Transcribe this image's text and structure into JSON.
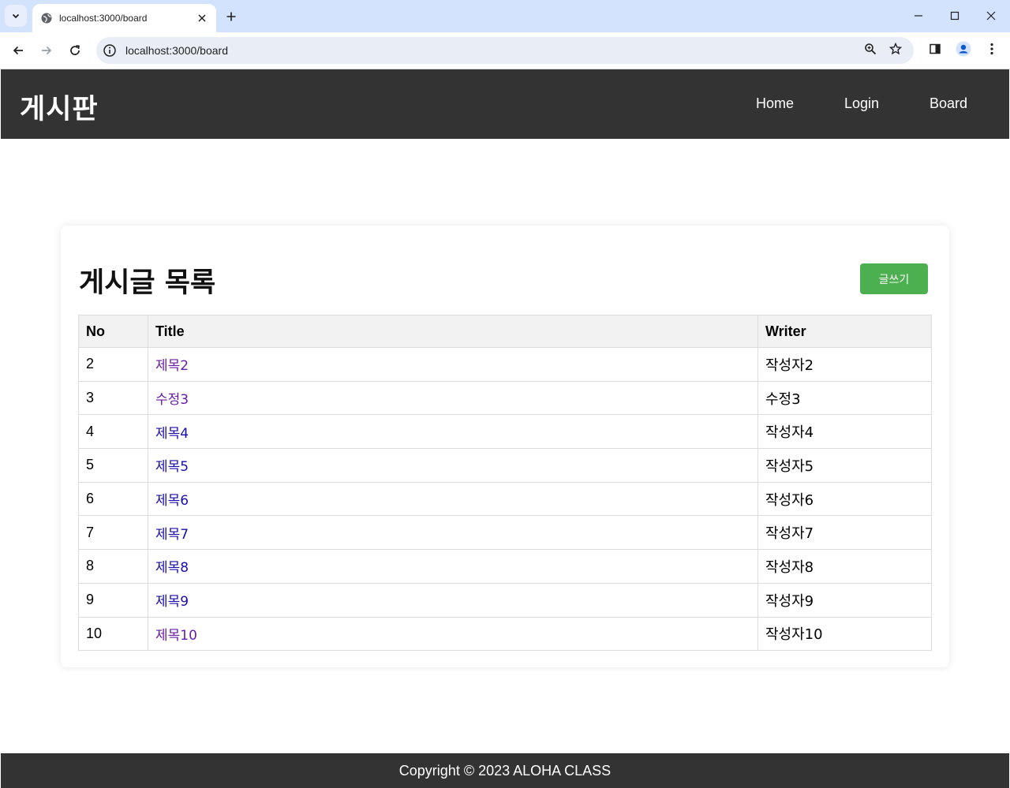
{
  "browser": {
    "tab_title": "localhost:3000/board",
    "url": "localhost:3000/board",
    "icons": [
      "tab-search-icon",
      "globe-icon",
      "close-icon",
      "plus-icon",
      "minimize-icon",
      "maximize-icon",
      "close-window-icon",
      "back-icon",
      "forward-icon",
      "reload-icon",
      "info-icon",
      "zoom-icon",
      "star-icon",
      "side-panel-icon",
      "profile-icon",
      "menu-icon"
    ]
  },
  "header": {
    "logo": "게시판",
    "nav": [
      "Home",
      "Login",
      "Board"
    ]
  },
  "board": {
    "title": "게시글 목록",
    "write_button": "글쓰기",
    "columns": [
      "No",
      "Title",
      "Writer"
    ],
    "rows": [
      {
        "no": "2",
        "title": "제목2",
        "writer": "작성자2",
        "visited": true
      },
      {
        "no": "3",
        "title": "수정3",
        "writer": "수정3",
        "visited": true
      },
      {
        "no": "4",
        "title": "제목4",
        "writer": "작성자4",
        "visited": false
      },
      {
        "no": "5",
        "title": "제목5",
        "writer": "작성자5",
        "visited": false
      },
      {
        "no": "6",
        "title": "제목6",
        "writer": "작성자6",
        "visited": false
      },
      {
        "no": "7",
        "title": "제목7",
        "writer": "작성자7",
        "visited": false
      },
      {
        "no": "8",
        "title": "제목8",
        "writer": "작성자8",
        "visited": false
      },
      {
        "no": "9",
        "title": "제목9",
        "writer": "작성자9",
        "visited": false
      },
      {
        "no": "10",
        "title": "제목10",
        "writer": "작성자10",
        "visited": true
      }
    ]
  },
  "footer": {
    "text": "Copyright © 2023 ALOHA CLASS"
  },
  "colors": {
    "header_bg": "#333333",
    "button_green": "#4caf50",
    "link_visited": "#681da8",
    "link_unvisited": "#1a0dab"
  }
}
